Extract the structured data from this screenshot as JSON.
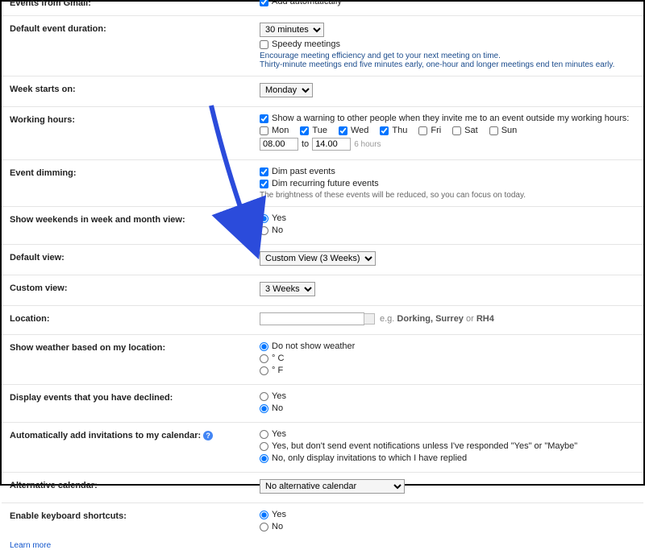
{
  "rows": {
    "events_gmail": {
      "label": "Events from Gmail:",
      "option": "Add automatically"
    },
    "default_duration": {
      "label": "Default event duration:",
      "select": "30 minutes",
      "speedy_label": "Speedy meetings",
      "note1": "Encourage meeting efficiency and get to your next meeting on time.",
      "note2": "Thirty-minute meetings end five minutes early, one-hour and longer meetings end ten minutes early."
    },
    "week_starts": {
      "label": "Week starts on:",
      "select": "Monday"
    },
    "working_hours": {
      "label": "Working hours:",
      "warning": "Show a warning to other people when they invite me to an event outside my working hours:",
      "days": [
        {
          "label": "Mon",
          "checked": false
        },
        {
          "label": "Tue",
          "checked": true
        },
        {
          "label": "Wed",
          "checked": true
        },
        {
          "label": "Thu",
          "checked": true
        },
        {
          "label": "Fri",
          "checked": false
        },
        {
          "label": "Sat",
          "checked": false
        },
        {
          "label": "Sun",
          "checked": false
        }
      ],
      "from": "08.00",
      "to_lbl": "to",
      "until": "14.00",
      "hint": "6 hours"
    },
    "event_dimming": {
      "label": "Event dimming:",
      "opt1": "Dim past events",
      "opt2": "Dim recurring future events",
      "note": "The brightness of these events will be reduced, so you can focus on today."
    },
    "show_weekends": {
      "label": "Show weekends in week and month view:",
      "yes": "Yes",
      "no": "No"
    },
    "default_view": {
      "label": "Default view:",
      "select": "Custom View (3 Weeks)"
    },
    "custom_view": {
      "label": "Custom view:",
      "select": "3 Weeks"
    },
    "location": {
      "label": "Location:",
      "hint_prefix": "e.g. ",
      "hint_b1": "Dorking, Surrey",
      "hint_mid": " or ",
      "hint_b2": "RH4"
    },
    "weather": {
      "label": "Show weather based on my location:",
      "opt1": "Do not show weather",
      "opt2": "° C",
      "opt3": "° F"
    },
    "declined": {
      "label": "Display events that you have declined:",
      "yes": "Yes",
      "no": "No"
    },
    "auto_invites": {
      "label": "Automatically add invitations to my calendar:",
      "opt1": "Yes",
      "opt2": "Yes, but don't send event notifications unless I've responded \"Yes\" or \"Maybe\"",
      "opt3": "No, only display invitations to which I have replied"
    },
    "alt_calendar": {
      "label": "Alternative calendar:",
      "select": "No alternative calendar"
    },
    "shortcuts": {
      "label": "Enable keyboard shortcuts:",
      "yes": "Yes",
      "no": "No"
    },
    "learn_more": "Learn more"
  }
}
